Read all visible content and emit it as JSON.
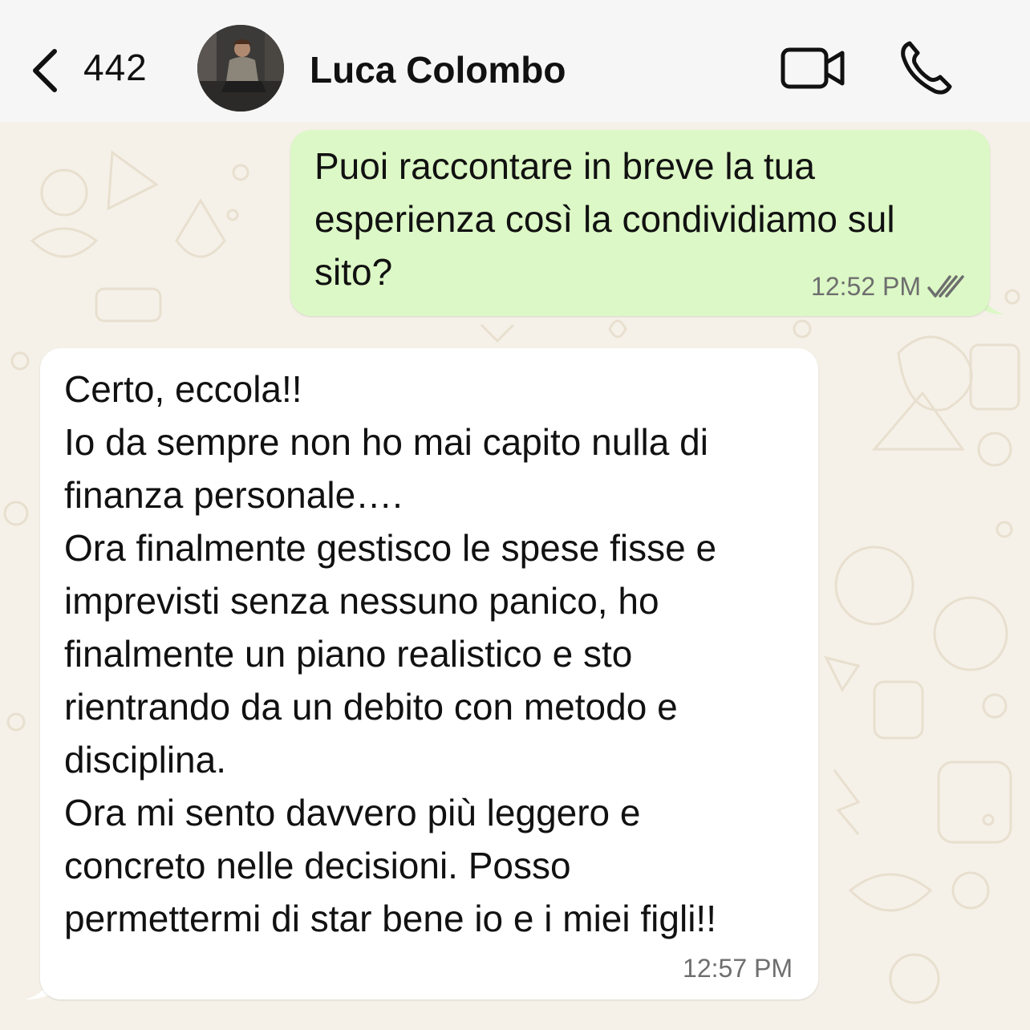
{
  "header": {
    "back_count": "442",
    "contact_name": "Luca Colombo"
  },
  "icons": {
    "back": "chevron-left",
    "video": "video-camera",
    "call": "phone",
    "read_receipt": "double-check"
  },
  "colors": {
    "outgoing_bubble": "#dcf8c6",
    "incoming_bubble": "#ffffff",
    "wallpaper": "#f5f1e8"
  },
  "messages": [
    {
      "direction": "outgoing",
      "text": "Puoi raccontare in breve la tua\nesperienza così la condividiamo sul\nsito?",
      "time": "12:52 PM",
      "status": "read"
    },
    {
      "direction": "incoming",
      "text": "Certo, eccola!!\nIo da sempre non ho mai capito nulla di\nfinanza personale….\nOra finalmente gestisco le spese fisse e\nimprevisti senza nessuno panico, ho\nfinalmente un piano realistico e sto\nrientrando da un debito con metodo e\ndisciplina.\nOra mi sento davvero più leggero e\nconcreto nelle decisioni. Posso\npermettermi di star bene io e i miei figli!!",
      "time": "12:57 PM"
    }
  ]
}
